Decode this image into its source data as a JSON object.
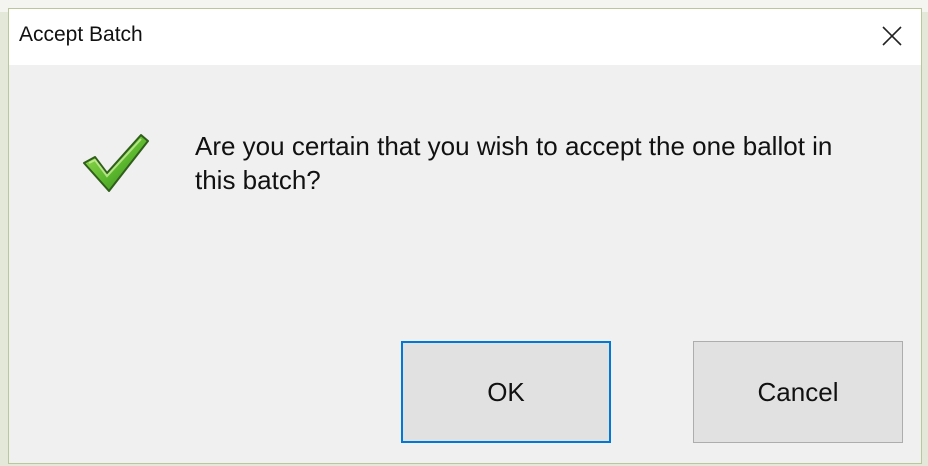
{
  "dialog": {
    "title": "Accept Batch",
    "message": "Are you certain that you wish to accept the one ballot in this batch?",
    "icon": "green-checkmark-icon",
    "ok_label": "OK",
    "cancel_label": "Cancel"
  },
  "colors": {
    "titlebar": "#ffffff",
    "body": "#f0f0f0",
    "button": "#e1e1e1",
    "default_button_border": "#0078d7",
    "check_green": "#5cb82e"
  }
}
